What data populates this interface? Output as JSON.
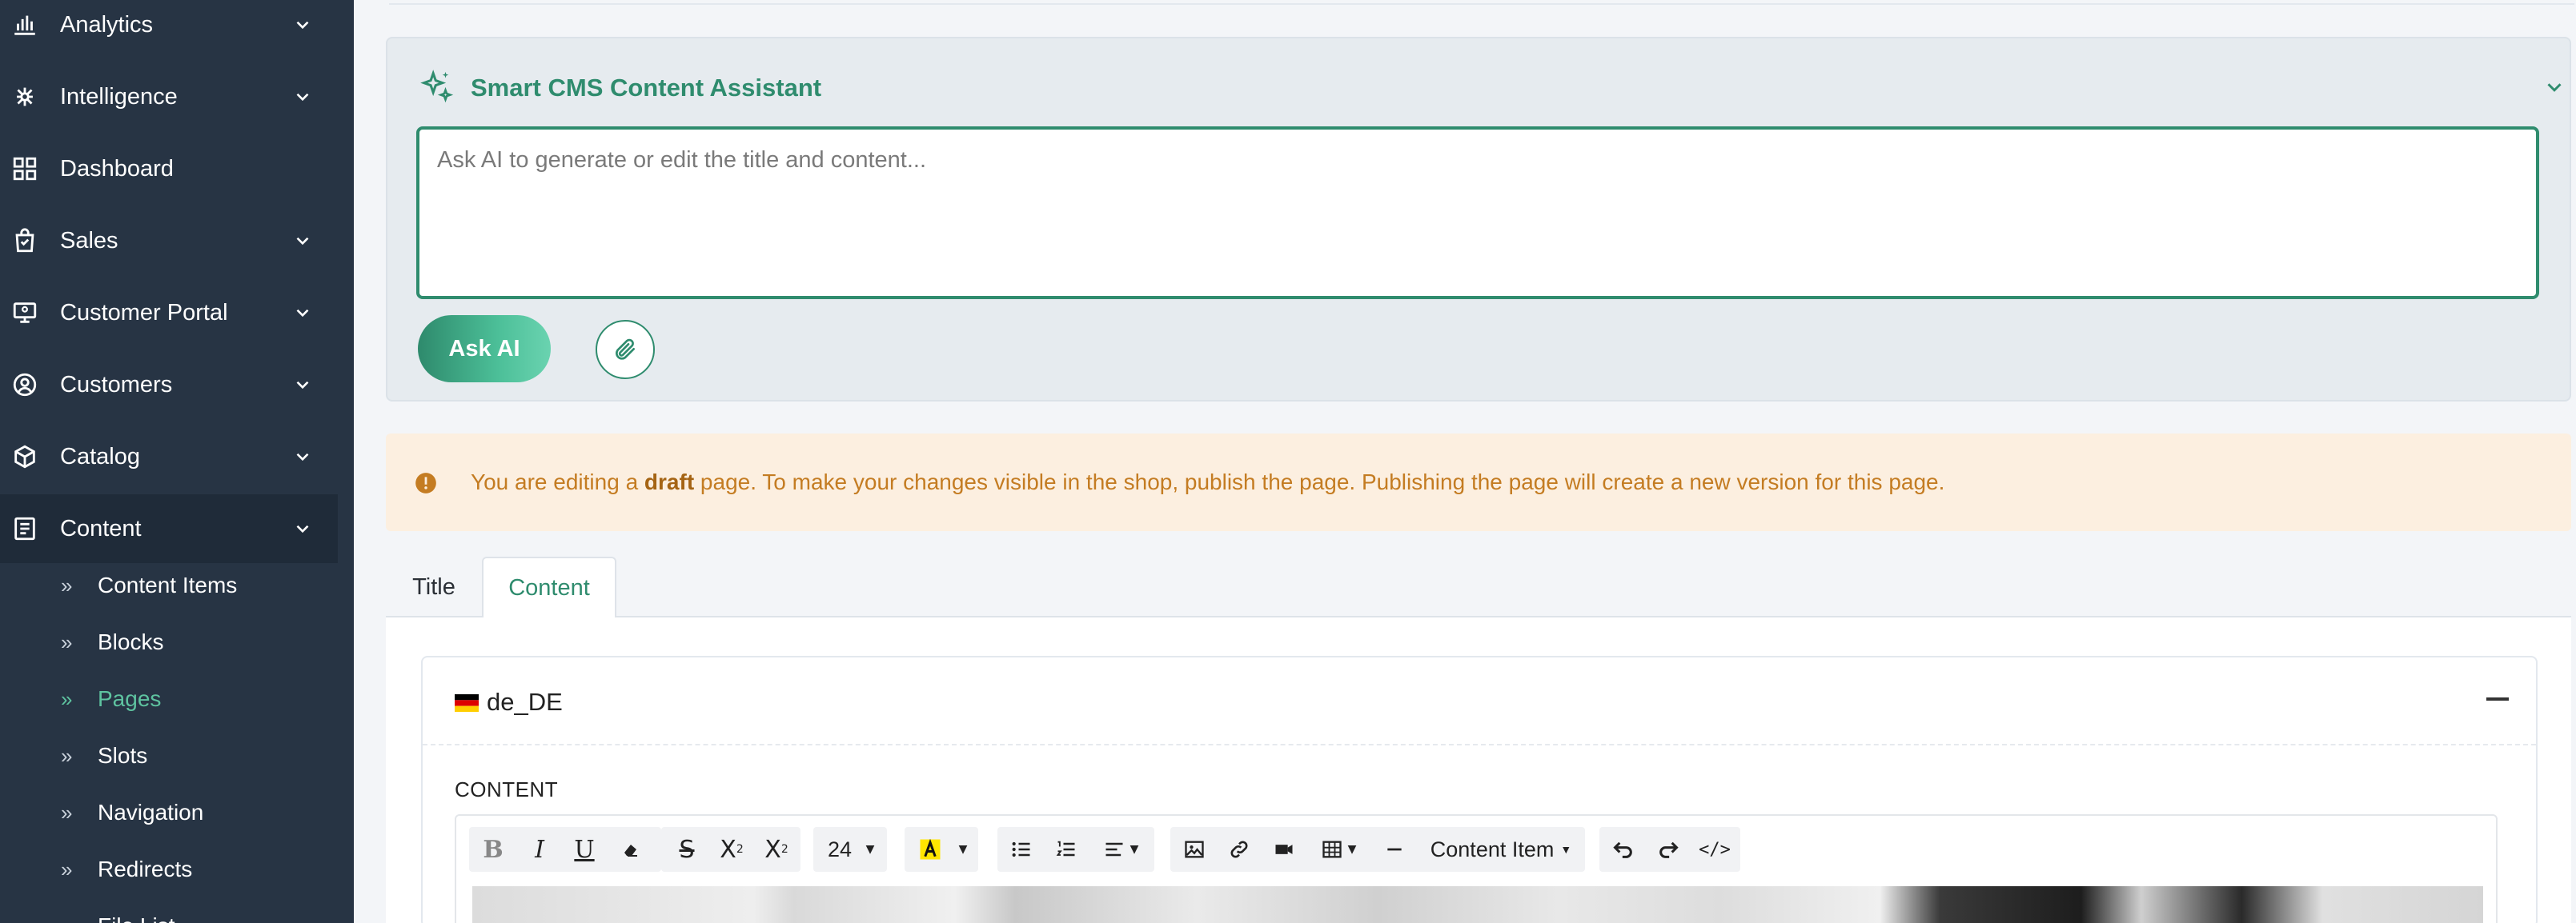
{
  "sidebar": {
    "items": [
      {
        "label": "Analytics",
        "icon": "bar-chart-icon",
        "has_chevron": true
      },
      {
        "label": "Intelligence",
        "icon": "brain-icon",
        "has_chevron": true
      },
      {
        "label": "Dashboard",
        "icon": "grid-icon",
        "has_chevron": false
      },
      {
        "label": "Sales",
        "icon": "shopping-bag-icon",
        "has_chevron": true
      },
      {
        "label": "Customer Portal",
        "icon": "monitor-icon",
        "has_chevron": true
      },
      {
        "label": "Customers",
        "icon": "user-circle-icon",
        "has_chevron": true
      },
      {
        "label": "Catalog",
        "icon": "box-icon",
        "has_chevron": true
      },
      {
        "label": "Content",
        "icon": "document-icon",
        "has_chevron": true,
        "active": true
      }
    ],
    "sub_items": [
      {
        "label": "Content Items"
      },
      {
        "label": "Blocks"
      },
      {
        "label": "Pages",
        "active": true
      },
      {
        "label": "Slots"
      },
      {
        "label": "Navigation"
      },
      {
        "label": "Redirects"
      },
      {
        "label": "File List"
      }
    ]
  },
  "ai_panel": {
    "title": "Smart CMS Content Assistant",
    "placeholder": "Ask AI to generate or edit the title and content...",
    "value": "",
    "ask_button": "Ask AI"
  },
  "notice": {
    "prefix": "You are editing a ",
    "bold": "draft",
    "suffix": " page. To make your changes visible in the shop, publish the page. Publishing the page will create a new version for this page."
  },
  "tabs": [
    {
      "label": "Title",
      "active": false
    },
    {
      "label": "Content",
      "active": true
    }
  ],
  "locale_card": {
    "locale": "de_DE",
    "field_label": "CONTENT"
  },
  "editor_toolbar": {
    "font_size": "24",
    "insert_menu": "Content Item"
  },
  "colors": {
    "sidebar_bg": "#273444",
    "accent": "#2f8c6e",
    "active_sub": "#5ec3a0",
    "notice_bg": "#fcefe0",
    "notice_text": "#c47c22"
  }
}
